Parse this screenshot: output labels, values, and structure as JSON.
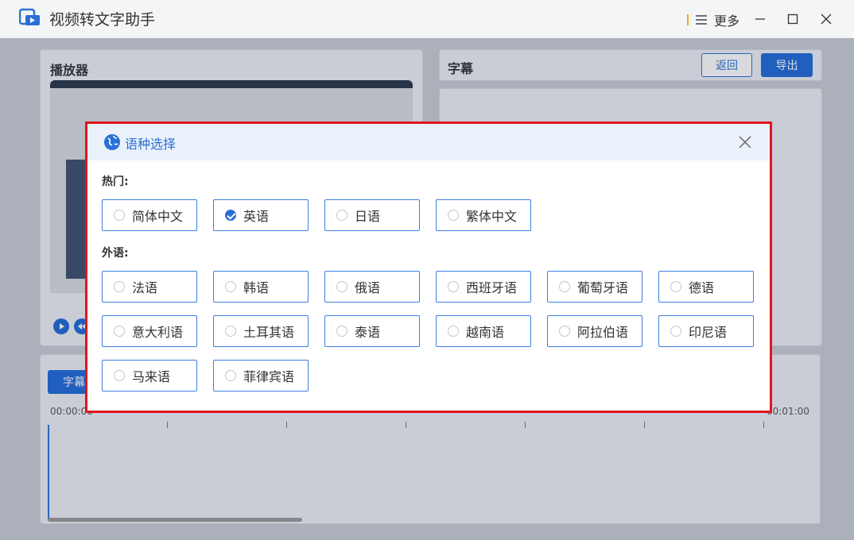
{
  "app": {
    "title": "视频转文字助手",
    "more_label": "更多"
  },
  "player": {
    "title": "播放器"
  },
  "subtitle": {
    "title": "字幕",
    "back_label": "返回",
    "export_label": "导出"
  },
  "timeline": {
    "tab_label": "字幕",
    "start_time": "00:00:00",
    "end_time": "00:01:00"
  },
  "dialog": {
    "title": "语种选择",
    "hot_label": "热门:",
    "foreign_label": "外语:",
    "hot_options": [
      {
        "label": "简体中文",
        "checked": false
      },
      {
        "label": "英语",
        "checked": true
      },
      {
        "label": "日语",
        "checked": false
      },
      {
        "label": "繁体中文",
        "checked": false
      }
    ],
    "foreign_options": [
      {
        "label": "法语"
      },
      {
        "label": "韩语"
      },
      {
        "label": "俄语"
      },
      {
        "label": "西班牙语"
      },
      {
        "label": "葡萄牙语"
      },
      {
        "label": "德语"
      },
      {
        "label": "意大利语"
      },
      {
        "label": "土耳其语"
      },
      {
        "label": "泰语"
      },
      {
        "label": "越南语"
      },
      {
        "label": "阿拉伯语"
      },
      {
        "label": "印尼语"
      },
      {
        "label": "马来语"
      },
      {
        "label": "菲律宾语"
      }
    ]
  },
  "colors": {
    "accent": "#2a6fd6",
    "dialog_border": "#e0161c"
  }
}
